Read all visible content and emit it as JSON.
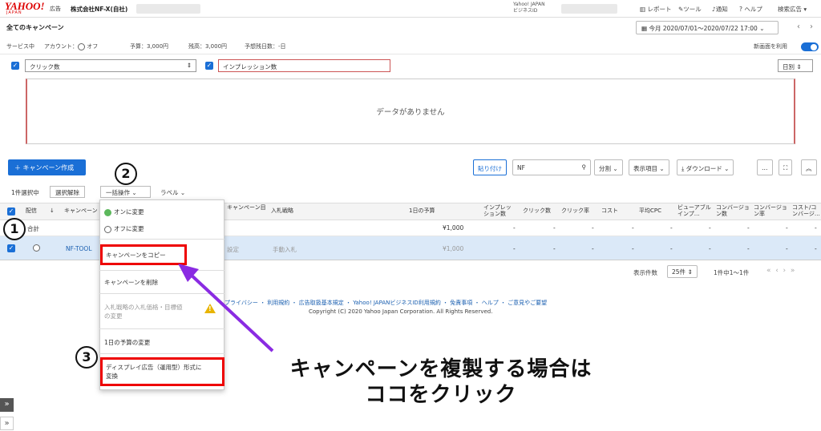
{
  "header": {
    "logo": "YAHOO!",
    "logo_sub": "JAPAN",
    "logo_ad": "広告",
    "company": "株式会社NF-X(自社)",
    "yj_line1": "Yahoo! JAPAN",
    "yj_line2": "ビジネスID",
    "nav": [
      "レポート",
      "ツール",
      "通知",
      "ヘルプ",
      "検索広告"
    ]
  },
  "title": "全てのキャンペーン",
  "date_range": "今月 2020/07/01〜2020/07/22 17:00",
  "status": {
    "service": "サービス中",
    "account_label": "アカウント：",
    "account_state": "オフ",
    "budget": "予算：3,000円",
    "balance": "残高：3,000円",
    "days": "予想残日数：-日",
    "new_screen": "新画面を利用"
  },
  "chart": {
    "metric1": "クリック数",
    "metric2": "インプレッション数",
    "period": "日別",
    "empty_message": "データがありません"
  },
  "toolbar": {
    "create": "＋ キャンペーン作成",
    "paste": "貼り付け",
    "search_value": "NF",
    "split": "分割",
    "columns": "表示項目",
    "download": "ダウンロード",
    "more": "…"
  },
  "selection": {
    "info": "1件選択中",
    "clear": "選択解除",
    "bulk": "一括操作",
    "label": "ラベル"
  },
  "table": {
    "headers": [
      "配信",
      "キャンペーン",
      "キャンペーン目",
      "入札戦略",
      "1日の予算",
      "インプレッション数",
      "クリック数",
      "クリック率",
      "コスト",
      "平均CPC",
      "ビューアブルインプ…",
      "コンバージョン数",
      "コンバージョン率",
      "コスト/コンバージ…"
    ],
    "total_label": "合計",
    "total_budget": "¥1,000",
    "row_name": "NF-TOOL",
    "row_goal": "設定",
    "row_bid": "手動入札",
    "row_budget": "¥1,000",
    "dash": "-"
  },
  "pager": {
    "per_page_label": "表示件数",
    "per_page": "25件",
    "range": "1件中1〜1件"
  },
  "footer": {
    "links": "プライバシー ・ 利用規約 ・ 広告取扱基本規定 ・ Yahoo! JAPANビジネスID利用規約 ・ 免責事項 ・ ヘルプ ・ ご意見やご要望",
    "copyright": "Copyright (C) 2020 Yahoo Japan Corporation. All Rights Reserved."
  },
  "menu": {
    "on": "オンに変更",
    "off": "オフに変更",
    "copy": "キャンペーンをコピー",
    "delete": "キャンペーンを削除",
    "bid_line1": "入札戦略の入札価格・目標値",
    "bid_line2": "の変更",
    "budget": "1日の予算の変更",
    "convert_line1": "ディスプレイ広告（運用型）形式に",
    "convert_line2": "変換"
  },
  "annotation": {
    "n1": "1",
    "n2": "2",
    "n3": "3",
    "line1": "キャンペーンを複製する場合は",
    "line2": "ココをクリック"
  },
  "colors": {
    "accent": "#1a6fd6",
    "highlight": "#e00000",
    "arrow": "#8a2be2"
  }
}
